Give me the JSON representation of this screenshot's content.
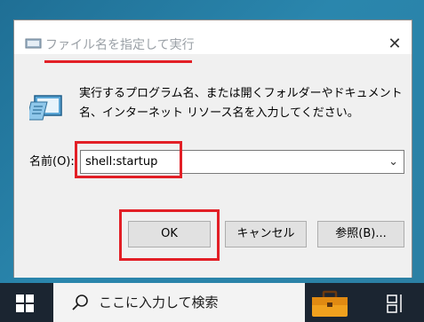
{
  "window": {
    "title": "ファイル名を指定して実行",
    "close_glyph": "✕",
    "description": "実行するプログラム名、または開くフォルダーやドキュメント名、インターネット リソース名を入力してください。",
    "name_label": "名前(O):",
    "input_value": "shell:startup",
    "dropdown_glyph": "⌄"
  },
  "buttons": {
    "ok": "OK",
    "cancel": "キャンセル",
    "browse": "参照(B)..."
  },
  "taskbar": {
    "search_placeholder": "ここに入力して検索"
  },
  "colors": {
    "highlight": "#e21f26",
    "desktop": "#2a86ad",
    "taskbar": "#1b2531"
  }
}
